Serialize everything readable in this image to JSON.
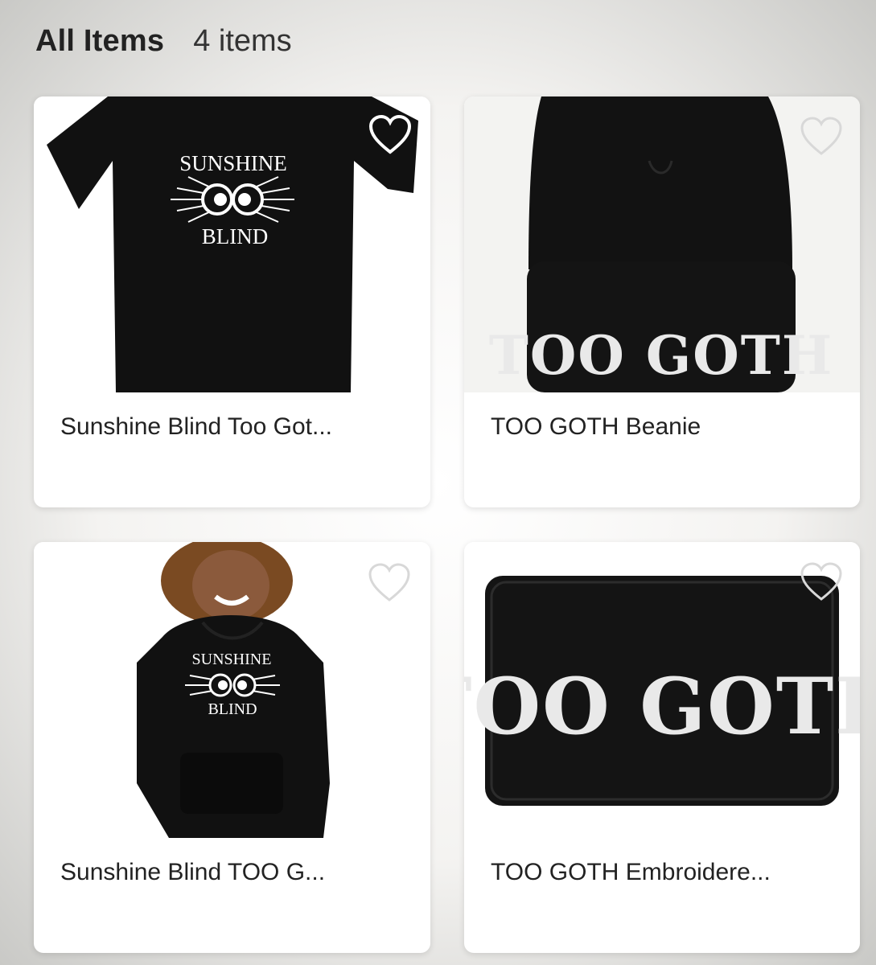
{
  "header": {
    "title": "All Items",
    "count": "4 items"
  },
  "products": [
    {
      "name": "Sunshine Blind Too Got...",
      "image": "black-tshirt",
      "logo_line1": "SUNSHINE",
      "logo_line2": "BLIND"
    },
    {
      "name": "TOO GOTH  Beanie",
      "image": "black-beanie",
      "stamp": "TOO GOTH"
    },
    {
      "name": "Sunshine Blind TOO G...",
      "image": "black-hoodie-model",
      "logo_line1": "SUNSHINE",
      "logo_line2": "BLIND"
    },
    {
      "name": "TOO GOTH Embroidere...",
      "image": "embroidered-patch",
      "stamp": "TOO GOTH"
    }
  ],
  "icons": {
    "favorite": "heart-outline-icon"
  },
  "colors": {
    "garment": "#111111",
    "text": "#222222",
    "card": "#ffffff"
  }
}
